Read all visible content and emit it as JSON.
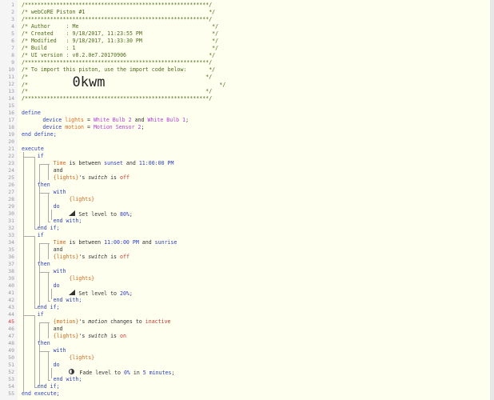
{
  "header": {
    "border": "/**********************************************************/",
    "title": "/* webCoRE Piston #1                                       */",
    "author": "/* Author     : Me                                          */",
    "created": "/* Created    : 9/18/2017, 11:23:55 PM                      */",
    "modified": "/* Modified   : 9/18/2017, 11:33:30 PM                      */",
    "build": "/* Build      : 1                                           */",
    "ui_version": "/* UI version : v0.2.0e7.20170906                          */",
    "import_text": "/* To import this piston, use the import code below:       */",
    "blank_comment": "/*                                                        */",
    "import_code_prefix": "/*              ",
    "import_code": "0kwm",
    "import_code_suffix": "                                    */"
  },
  "define": {
    "keyword": "define",
    "end": "end define;",
    "devices": [
      {
        "kw": "device",
        "var": "lights",
        "eq": " = ",
        "d1": "White Bulb 2",
        "and": " and ",
        "d2": "White Bulb 1",
        "end": ";"
      },
      {
        "kw": "device",
        "var": "motion",
        "eq": " = ",
        "d1": "Motion Sensor 2",
        "end": ";"
      }
    ]
  },
  "execute": {
    "keyword": "execute",
    "end": "end execute;",
    "if_kw": "if",
    "then_kw": "then",
    "end_if": "end if;",
    "and_kw": "and",
    "with_kw": "with",
    "do_kw": "do",
    "end_with": "end with;",
    "block1": {
      "cond1": {
        "attr": "Time",
        "op": " is between ",
        "a": "sunset",
        "and": " and ",
        "b": "11:00:00 PM"
      },
      "cond2": {
        "dev": "{lights}",
        "poss": "'s ",
        "cap": "switch",
        "op": " is ",
        "val": "off"
      },
      "with_dev": "{lights}",
      "action": {
        "text": "Set level to ",
        "num": "80%",
        "end": ";"
      }
    },
    "block2": {
      "cond1": {
        "attr": "Time",
        "op": " is between ",
        "a": "11:00:00 PM",
        "and": " and ",
        "b": "sunrise"
      },
      "cond2": {
        "dev": "{lights}",
        "poss": "'s ",
        "cap": "switch",
        "op": " is ",
        "val": "off"
      },
      "with_dev": "{lights}",
      "action": {
        "text": "Set level to ",
        "num": "20%",
        "end": ";"
      }
    },
    "block3": {
      "cond1": {
        "dev": "{motion}",
        "poss": "'s ",
        "cap": "motion",
        "op": " changes to ",
        "val": "inactive"
      },
      "cond2": {
        "dev": "{lights}",
        "poss": "'s ",
        "cap": "switch",
        "op": " is ",
        "val": "on"
      },
      "with_dev": "{lights}",
      "action": {
        "text": "Fade level to ",
        "num": "0%",
        "mid": " in ",
        "num2": "5 minutes",
        "end": ";"
      }
    }
  },
  "line_numbers": [
    "1",
    "2",
    "3",
    "4",
    "5",
    "6",
    "7",
    "8",
    "9",
    "10",
    "11",
    "12",
    "13",
    "14",
    "15",
    "16",
    "17",
    "18",
    "19",
    "20",
    "21",
    "22",
    "23",
    "24",
    "25",
    "26",
    "27",
    "28",
    "29",
    "30",
    "31",
    "32",
    "33",
    "34",
    "35",
    "36",
    "37",
    "38",
    "39",
    "40",
    "41",
    "42",
    "43",
    "44",
    "45",
    "46",
    "47",
    "48",
    "49",
    "50",
    "51",
    "52",
    "53",
    "54",
    "55"
  ]
}
